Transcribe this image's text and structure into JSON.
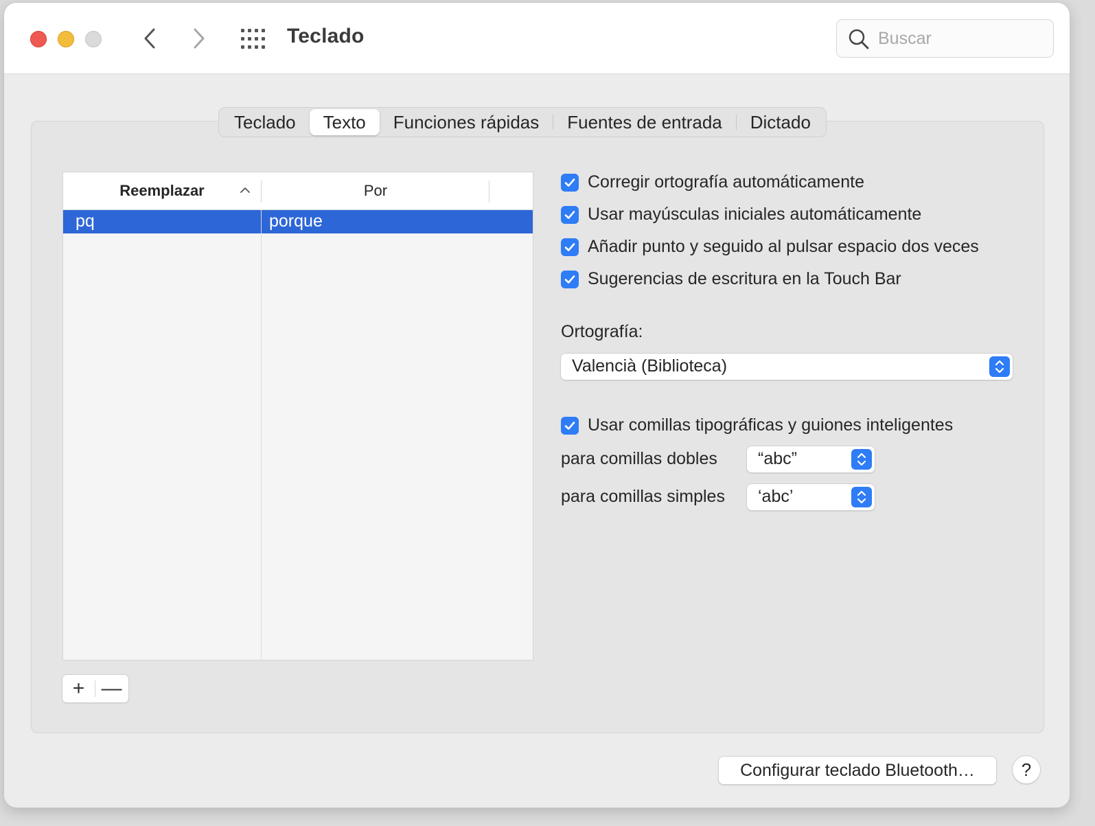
{
  "window": {
    "title": "Teclado"
  },
  "search": {
    "placeholder": "Buscar"
  },
  "tabs": [
    {
      "label": "Teclado"
    },
    {
      "label": "Texto",
      "selected": true
    },
    {
      "label": "Funciones rápidas"
    },
    {
      "label": "Fuentes de entrada"
    },
    {
      "label": "Dictado"
    }
  ],
  "table": {
    "columns": [
      "Reemplazar",
      "Por"
    ],
    "rows": [
      {
        "replace": "pq",
        "with": "porque",
        "selected": true
      }
    ]
  },
  "list_controls": {
    "add": "+",
    "remove": "—"
  },
  "options": [
    {
      "label": "Corregir ortografía automáticamente",
      "checked": true
    },
    {
      "label": "Usar mayúsculas iniciales automáticamente",
      "checked": true
    },
    {
      "label": "Añadir punto y seguido al pulsar espacio dos veces",
      "checked": true
    },
    {
      "label": "Sugerencias de escritura en la Touch Bar",
      "checked": true
    }
  ],
  "spelling": {
    "label": "Ortografía:",
    "value": "Valencià (Biblioteca)"
  },
  "smart_quotes": {
    "label": "Usar comillas tipográficas y guiones inteligentes",
    "checked": true,
    "double_label": "para comillas dobles",
    "double_value": "“abc”",
    "single_label": "para comillas simples",
    "single_value": "‘abc’"
  },
  "footer": {
    "bluetooth_button": "Configurar teclado Bluetooth…",
    "help": "?"
  },
  "colors": {
    "accent": "#2e7cf6",
    "selection": "#2d66d7",
    "close": "#ee5a52",
    "minimize": "#f4bc3c"
  }
}
